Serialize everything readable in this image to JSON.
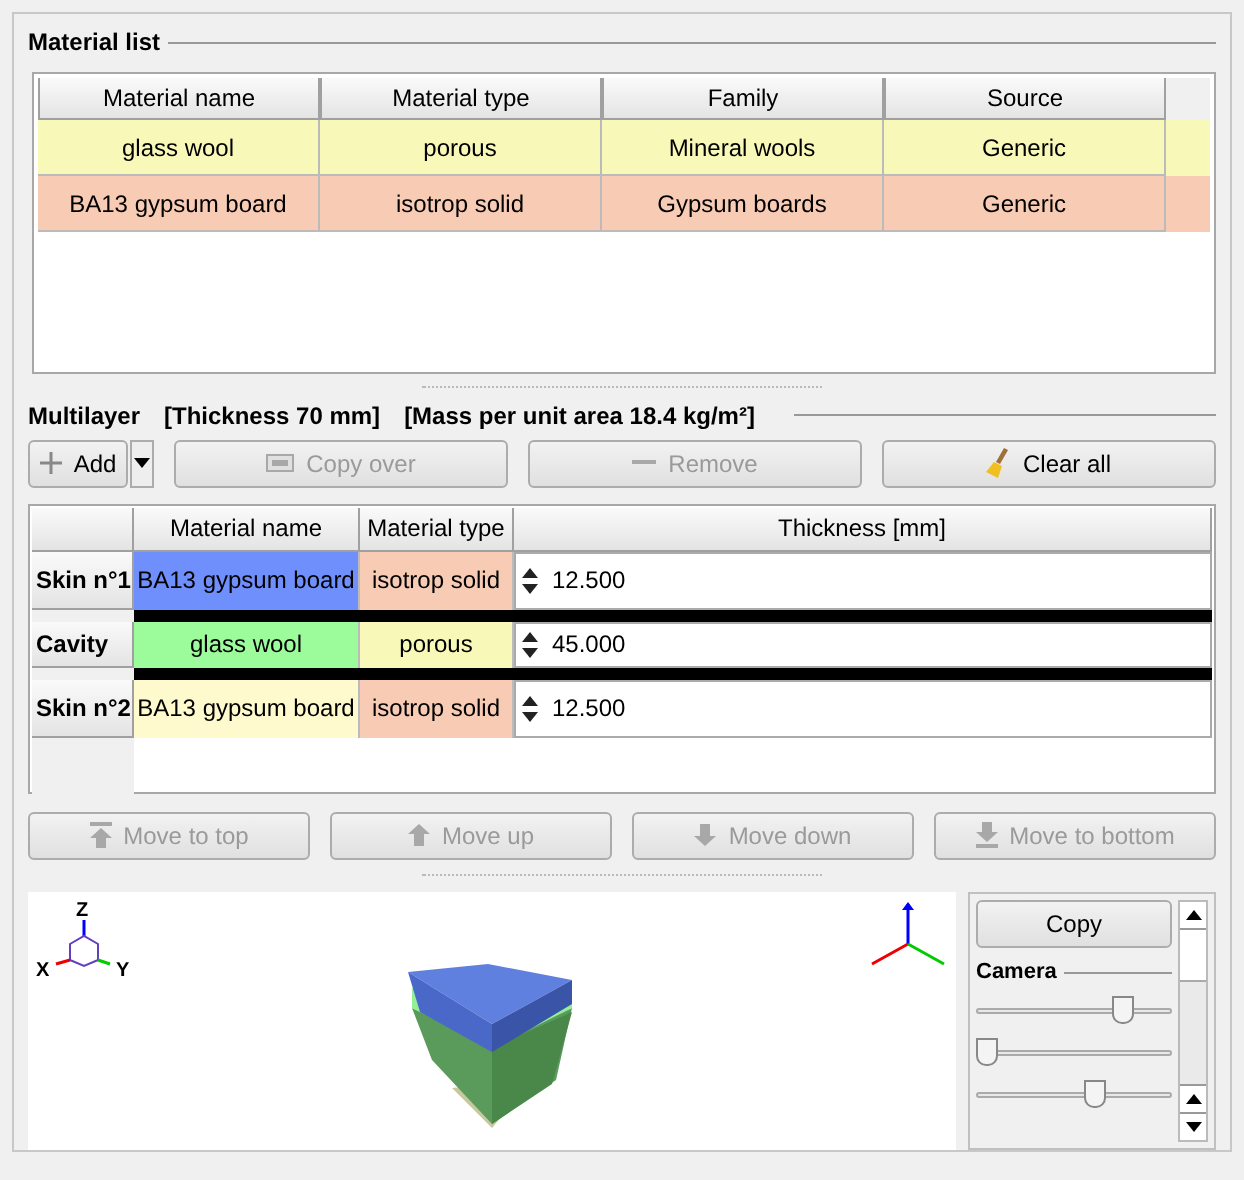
{
  "material_list": {
    "title": "Material list",
    "columns": [
      "Material name",
      "Material type",
      "Family",
      "Source"
    ],
    "rows": [
      {
        "color": "#f8f8b8",
        "cells": [
          "glass wool",
          "porous",
          "Mineral wools",
          "Generic"
        ]
      },
      {
        "color": "#f8cbb4",
        "cells": [
          "BA13 gypsum board",
          "isotrop solid",
          "Gypsum boards",
          "Generic"
        ]
      }
    ]
  },
  "multilayer": {
    "title": "Multilayer",
    "thickness": "[Thickness 70 mm]",
    "mass": "[Mass per unit area 18.4 kg/m²]",
    "add_button": {
      "label": "Add",
      "disabled": false
    },
    "buttons": [
      {
        "label": "Copy over",
        "disabled": true
      },
      {
        "label": "Remove",
        "disabled": true
      },
      {
        "label": "Clear all",
        "disabled": false
      }
    ],
    "columns": [
      "Material name",
      "Material type",
      "Thickness [mm]"
    ],
    "layers": [
      {
        "header": "Skin n°1",
        "name": {
          "text": "BA13 gypsum board",
          "color": "#6f8ffc"
        },
        "type": {
          "text": "isotrop solid",
          "color": "#f8cbb4"
        },
        "thickness": "12.500"
      },
      {
        "header": "Cavity",
        "name": {
          "text": "glass wool",
          "color": "#9cfc9c"
        },
        "type": {
          "text": "porous",
          "color": "#f8f8b8"
        },
        "thickness": "45.000"
      },
      {
        "header": "Skin n°2",
        "name": {
          "text": "BA13 gypsum board",
          "color": "#fffacd"
        },
        "type": {
          "text": "isotrop solid",
          "color": "#f8cbb4"
        },
        "thickness": "12.500"
      }
    ],
    "move_buttons": [
      {
        "label": "Move to top",
        "disabled": true
      },
      {
        "label": "Move up",
        "disabled": true
      },
      {
        "label": "Move down",
        "disabled": true
      },
      {
        "label": "Move to bottom",
        "disabled": true
      }
    ]
  },
  "viewer": {
    "axes": [
      "Z",
      "X",
      "Y"
    ],
    "copy_button": "Copy",
    "camera": {
      "title": "Camera",
      "sliders": [
        {
          "level": 0.78
        },
        {
          "level": 0.0
        },
        {
          "level": 0.62
        }
      ]
    }
  }
}
